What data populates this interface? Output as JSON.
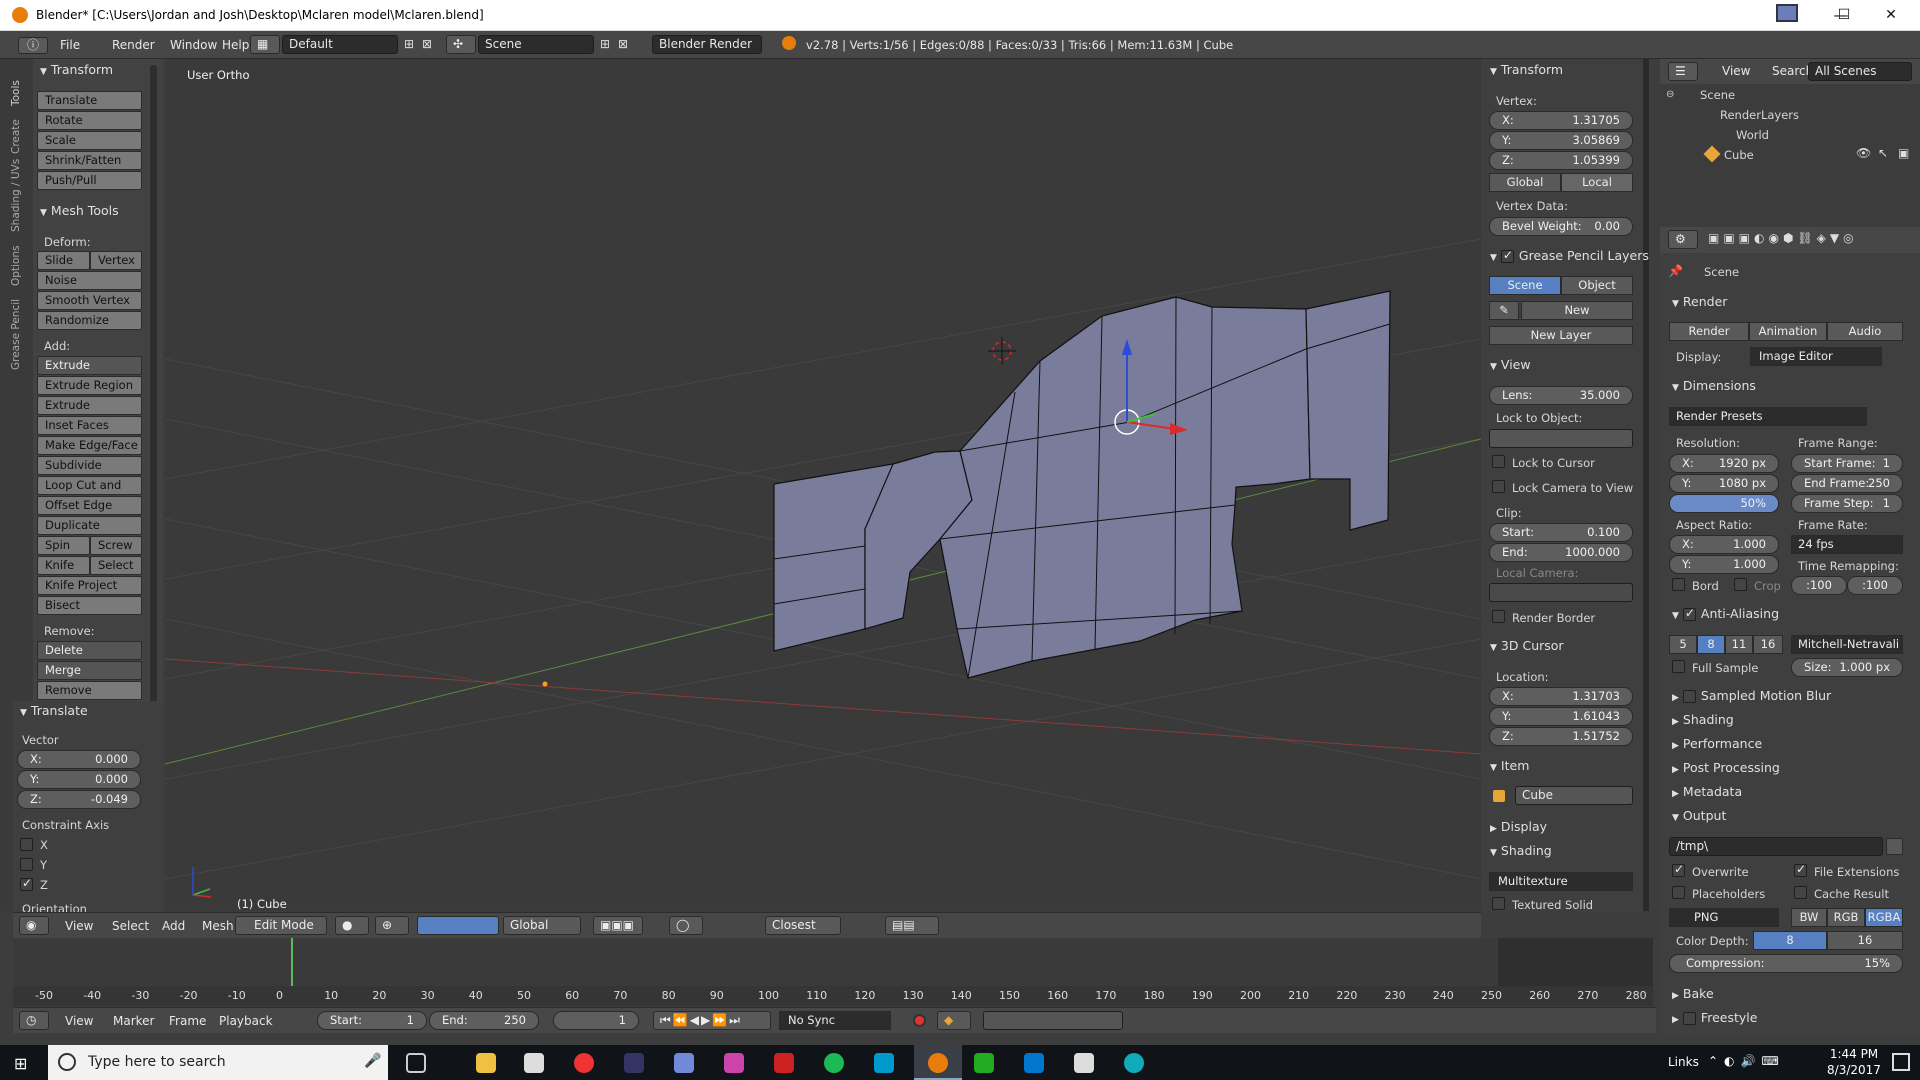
{
  "window": {
    "title": "Blender* [C:\\Users\\Jordan and Josh\\Desktop\\Mclaren model\\Mclaren.blend]",
    "min": "—",
    "max": "☐",
    "close": "✕"
  },
  "menu": {
    "file": "File",
    "render": "Render",
    "window": "Window",
    "help": "Help",
    "layout": "Default",
    "scene": "Scene",
    "engine": "Blender Render",
    "stats": "v2.78 | Verts:1/56 | Edges:0/88 | Faces:0/33 | Tris:66 | Mem:11.63M | Cube"
  },
  "sidetabs": [
    "Tools",
    "Create",
    "Shading / UVs",
    "Options",
    "Grease Pencil"
  ],
  "tools": {
    "transform_header": "Transform",
    "transform": [
      "Translate",
      "Rotate",
      "Scale",
      "Shrink/Fatten",
      "Push/Pull"
    ],
    "meshtools_header": "Mesh Tools",
    "deform_label": "Deform:",
    "slide_edge": "Slide Ed",
    "vertex": "Vertex",
    "noise": "Noise",
    "smooth_vertex": "Smooth Vertex",
    "randomize": "Randomize",
    "add_label": "Add:",
    "extrude": "Extrude",
    "extrude_region": "Extrude Region",
    "extrude_individual": "Extrude Individual",
    "inset_faces": "Inset Faces",
    "make_edge_face": "Make Edge/Face",
    "subdivide": "Subdivide",
    "loop_cut": "Loop Cut and Slide",
    "offset_edge": "Offset Edge Slide",
    "duplicate": "Duplicate",
    "spin": "Spin",
    "screw": "Screw",
    "knife": "Knife",
    "select": "Select",
    "knife_project": "Knife Project",
    "bisect": "Bisect",
    "remove_label": "Remove:",
    "delete": "Delete",
    "merge": "Merge",
    "remove_doubles": "Remove Doubles"
  },
  "operator": {
    "header": "Translate",
    "vector_label": "Vector",
    "x_label": "X:",
    "x": "0.000",
    "y_label": "Y:",
    "y": "0.000",
    "z_label": "Z:",
    "z": "-0.049",
    "constraint_label": "Constraint Axis",
    "cx": "X",
    "cy": "Y",
    "cz": "Z",
    "orientation": "Orientation"
  },
  "viewport": {
    "view_name": "User Ortho",
    "object_label": "(1) Cube"
  },
  "vp_header": {
    "view": "View",
    "select": "Select",
    "add": "Add",
    "mesh": "Mesh",
    "mode": "Edit Mode",
    "orientation": "Global",
    "snap": "Closest"
  },
  "npanel": {
    "transform_header": "Transform",
    "vertex_label": "Vertex:",
    "vx_label": "X:",
    "vx": "1.31705",
    "vy_label": "Y:",
    "vy": "3.05869",
    "vz_label": "Z:",
    "vz": "1.05399",
    "global": "Global",
    "local": "Local",
    "vertex_data": "Vertex Data:",
    "bevel_label": "Bevel Weight:",
    "bevel": "0.00",
    "gp_header": "Grease Pencil Layers",
    "gp_scene": "Scene",
    "gp_object": "Object",
    "gp_new": "New",
    "gp_new_layer": "New Layer",
    "view_header": "View",
    "lens_label": "Lens:",
    "lens": "35.000",
    "lock_object": "Lock to Object:",
    "lock_cursor": "Lock to Cursor",
    "lock_camera": "Lock Camera to View",
    "clip_label": "Clip:",
    "clip_start_label": "Start:",
    "clip_start": "0.100",
    "clip_end_label": "End:",
    "clip_end": "1000.000",
    "local_camera": "Local Camera:",
    "render_border": "Render Border",
    "cursor_header": "3D Cursor",
    "location_label": "Location:",
    "cx_label": "X:",
    "cx": "1.31703",
    "cy_label": "Y:",
    "cy": "1.61043",
    "cz_label": "Z:",
    "cz": "1.51752",
    "item_header": "Item",
    "item_name": "Cube",
    "display_header": "Display",
    "shading_header": "Shading",
    "shading_mode": "Multitexture",
    "textured_solid": "Textured Solid"
  },
  "outliner": {
    "view": "View",
    "search": "Search",
    "all_scenes": "All Scenes",
    "scene": "Scene",
    "renderlayers": "RenderLayers",
    "world": "World",
    "cube": "Cube"
  },
  "props": {
    "scene": "Scene",
    "render_header": "Render",
    "render_btn": "Render",
    "animation_btn": "Animation",
    "audio_btn": "Audio",
    "display_label": "Display:",
    "display_val": "Image Editor",
    "dimensions_header": "Dimensions",
    "presets": "Render Presets",
    "resolution_label": "Resolution:",
    "res_x_label": "X:",
    "res_x": "1920 px",
    "res_y_label": "Y:",
    "res_y": "1080 px",
    "res_pct": "50%",
    "frame_range_label": "Frame Range:",
    "start_label": "Start Frame:",
    "start": "1",
    "end_label": "End Frame:",
    "end": "250",
    "step_label": "Frame Step:",
    "step": "1",
    "aspect_label": "Aspect Ratio:",
    "ax_label": "X:",
    "ax": "1.000",
    "ay_label": "Y:",
    "ay": "1.000",
    "frame_rate_label": "Frame Rate:",
    "fps": "24 fps",
    "bord": "Bord",
    "crop": "Crop",
    "time_remap": "Time Remapping:",
    "remap_old": ":100",
    "remap_new": ":100",
    "aa_header": "Anti-Aliasing",
    "aa5": "5",
    "aa8": "8",
    "aa11": "11",
    "aa16": "16",
    "filter": "Mitchell-Netravali",
    "full_sample": "Full Sample",
    "size_label": "Size:",
    "size": "1.000 px",
    "motion_blur": "Sampled Motion Blur",
    "shading": "Shading",
    "performance": "Performance",
    "post": "Post Processing",
    "metadata": "Metadata",
    "output_header": "Output",
    "path": "/tmp\\",
    "overwrite": "Overwrite",
    "file_ext": "File Extensions",
    "placeholders": "Placeholders",
    "cache": "Cache Result",
    "format": "PNG",
    "bw": "BW",
    "rgb": "RGB",
    "rgba": "RGBA",
    "depth_label": "Color Depth:",
    "d8": "8",
    "d16": "16",
    "compression": "Compression:",
    "comp_val": "15%",
    "bake": "Bake",
    "freestyle": "Freestyle"
  },
  "timeline": {
    "ticks": [
      "-50",
      "-40",
      "-30",
      "-20",
      "-10",
      "0",
      "10",
      "20",
      "30",
      "40",
      "50",
      "60",
      "70",
      "80",
      "90",
      "100",
      "110",
      "120",
      "130",
      "140",
      "150",
      "160",
      "170",
      "180",
      "190",
      "200",
      "210",
      "220",
      "230",
      "240",
      "250",
      "260",
      "270",
      "280"
    ],
    "view": "View",
    "marker": "Marker",
    "frame": "Frame",
    "playback": "Playback",
    "start_label": "Start:",
    "start": "1",
    "end_label": "End:",
    "end": "250",
    "current": "1",
    "sync": "No Sync"
  },
  "taskbar": {
    "search": "Type here to search",
    "links": "Links",
    "time": "1:44 PM",
    "date": "8/3/2017"
  }
}
